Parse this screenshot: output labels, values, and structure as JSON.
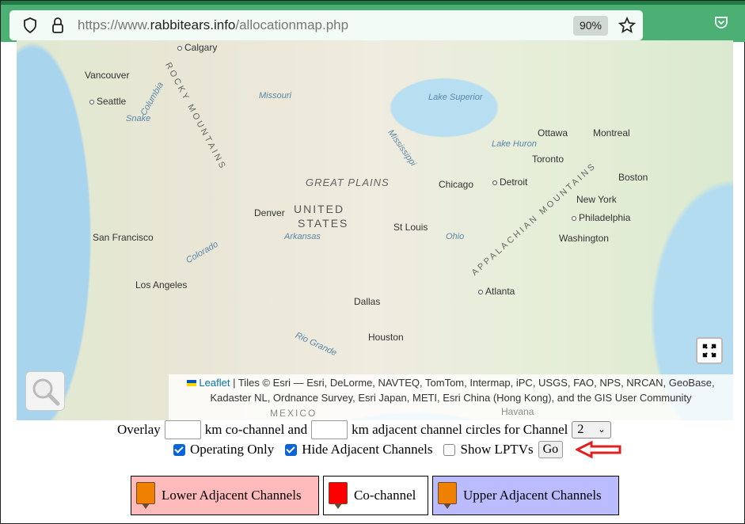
{
  "browser": {
    "url_prefix": "https://www.",
    "url_domain": "rabbitears.info",
    "url_path": "/allocationmap.php",
    "zoom": "90%"
  },
  "map": {
    "cities": [
      "Calgary",
      "Vancouver",
      "Seattle",
      "San Francisco",
      "Los Angeles",
      "Denver",
      "Dallas",
      "Houston",
      "St Louis",
      "Chicago",
      "Detroit",
      "Toronto",
      "Ottawa",
      "Montreal",
      "Boston",
      "New York",
      "Philadelphia",
      "Washington",
      "Atlanta"
    ],
    "regions": {
      "country1": "UNITED",
      "country2": "STATES",
      "plains": "GREAT PLAINS",
      "rockies": "ROCKY MOUNTAINS",
      "appalachian": "APPALACHIAN MOUNTAINS",
      "mexico": "MEXICO",
      "havana": "Havana"
    },
    "water": [
      "Lake Superior",
      "Lake Huron",
      "Missouri",
      "Mississippi",
      "Arkansas",
      "Colorado",
      "Snake",
      "Columbia",
      "Ohio",
      "Rio Grande"
    ],
    "attribution": {
      "leaflet": "Leaflet",
      "rest": "| Tiles © Esri — Esri, DeLorme, NAVTEQ, TomTom, Intermap, iPC, USGS, FAO, NPS, NRCAN, GeoBase, Kadaster NL, Ordnance Survey, Esri Japan, METI, Esri China (Hong Kong), and the GIS User Community"
    }
  },
  "controls": {
    "overlay": "Overlay",
    "co_channel": "km co-channel and",
    "adjacent": "km adjacent channel circles for Channel",
    "co_value": "",
    "adj_value": "",
    "channel": "2",
    "operating_only": "Operating Only",
    "hide_adjacent": "Hide Adjacent Channels",
    "show_lptv": "Show LPTVs",
    "go": "Go"
  },
  "legend": [
    {
      "label": "Lower Adjacent Channels",
      "bg": "#ffbbbb",
      "pin": "#f08000"
    },
    {
      "label": "Co-channel",
      "bg": "#ffffff",
      "pin": "#ff0000"
    },
    {
      "label": "Upper Adjacent Channels",
      "bg": "#bbbbff",
      "pin": "#f08000"
    }
  ],
  "colors": {
    "browser_bar": "#4caf73",
    "arrow": "#e02020"
  }
}
